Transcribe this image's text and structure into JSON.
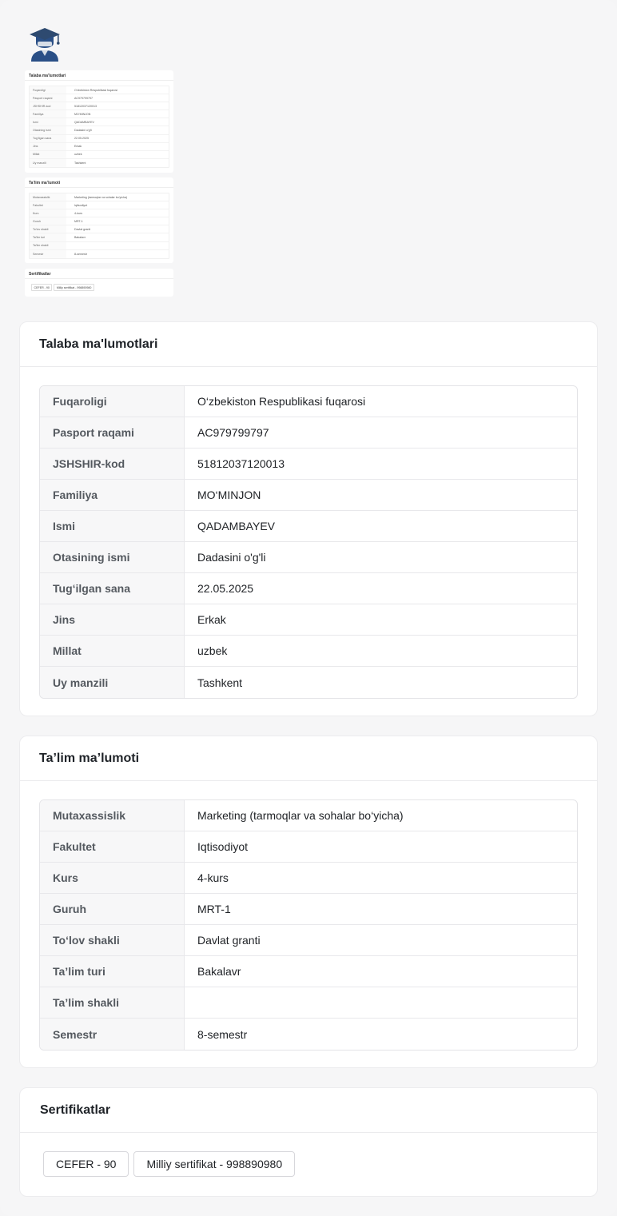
{
  "student_info": {
    "title": "Talaba ma'lumotlari",
    "rows": [
      {
        "label": "Fuqaroligi",
        "value": "O‘zbekiston Respublikasi fuqarosi"
      },
      {
        "label": "Pasport raqami",
        "value": "AC979799797"
      },
      {
        "label": "JSHSHIR-kod",
        "value": "51812037120013"
      },
      {
        "label": "Familiya",
        "value": "MO‘MINJON"
      },
      {
        "label": "Ismi",
        "value": "QADAMBAYEV"
      },
      {
        "label": "Otasining ismi",
        "value": "Dadasini o'g'li"
      },
      {
        "label": "Tug‘ilgan sana",
        "value": "22.05.2025"
      },
      {
        "label": "Jins",
        "value": "Erkak"
      },
      {
        "label": "Millat",
        "value": "uzbek"
      },
      {
        "label": "Uy manzili",
        "value": "Tashkent"
      }
    ]
  },
  "education_info": {
    "title": "Ta’lim ma’lumoti",
    "rows": [
      {
        "label": "Mutaxassislik",
        "value": "Marketing (tarmoqlar va sohalar bo‘yicha)"
      },
      {
        "label": "Fakultet",
        "value": "Iqtisodiyot"
      },
      {
        "label": "Kurs",
        "value": "4-kurs"
      },
      {
        "label": "Guruh",
        "value": "MRT-1"
      },
      {
        "label": "To‘lov shakli",
        "value": "Davlat granti"
      },
      {
        "label": "Ta’lim turi",
        "value": "Bakalavr"
      },
      {
        "label": "Ta’lim shakli",
        "value": ""
      },
      {
        "label": "Semestr",
        "value": "8-semestr"
      }
    ]
  },
  "certificates": {
    "title": "Sertifikatlar",
    "items": [
      "CEFER - 90",
      "Milliy sertifikat - 998890980"
    ]
  },
  "colors": {
    "icon_cap": "#2e4a70",
    "icon_face": "#2a4f86",
    "icon_mask": "#d6dde6"
  },
  "icons": {
    "avatar": "student-graduate-icon"
  }
}
